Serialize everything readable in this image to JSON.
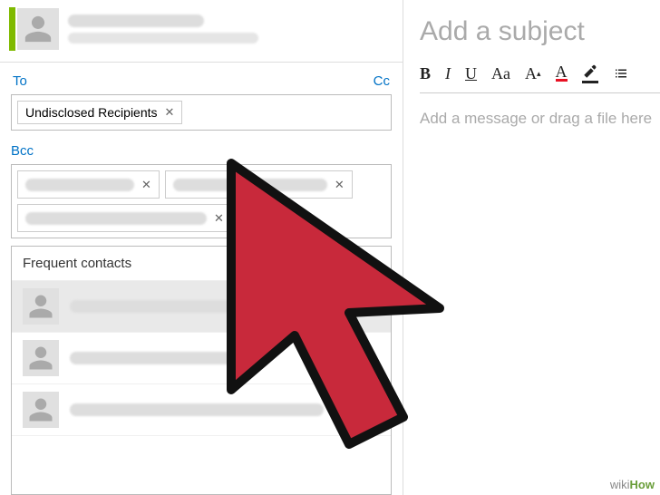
{
  "sender": {
    "name_hidden": true,
    "email_hidden": true
  },
  "fields": {
    "to_label": "To",
    "cc_label": "Cc",
    "bcc_label": "Bcc"
  },
  "to_chips": [
    {
      "label": "Undisclosed Recipients"
    }
  ],
  "bcc_chips": [
    {
      "hidden": true
    },
    {
      "hidden": true
    },
    {
      "hidden": true
    }
  ],
  "suggestions": {
    "header": "Frequent contacts",
    "items": [
      {
        "selected": true,
        "hidden": true
      },
      {
        "selected": false,
        "hidden": true
      },
      {
        "selected": false,
        "hidden": true
      }
    ]
  },
  "compose": {
    "subject_placeholder": "Add a subject",
    "body_placeholder": "Add a message or drag a file here"
  },
  "toolbar": {
    "bold": "B",
    "italic": "I",
    "underline": "U",
    "font": "Aa",
    "size_inc": "A",
    "color": "A",
    "highlight": "✎"
  },
  "watermark": {
    "prefix": "wiki",
    "suffix": "How"
  }
}
